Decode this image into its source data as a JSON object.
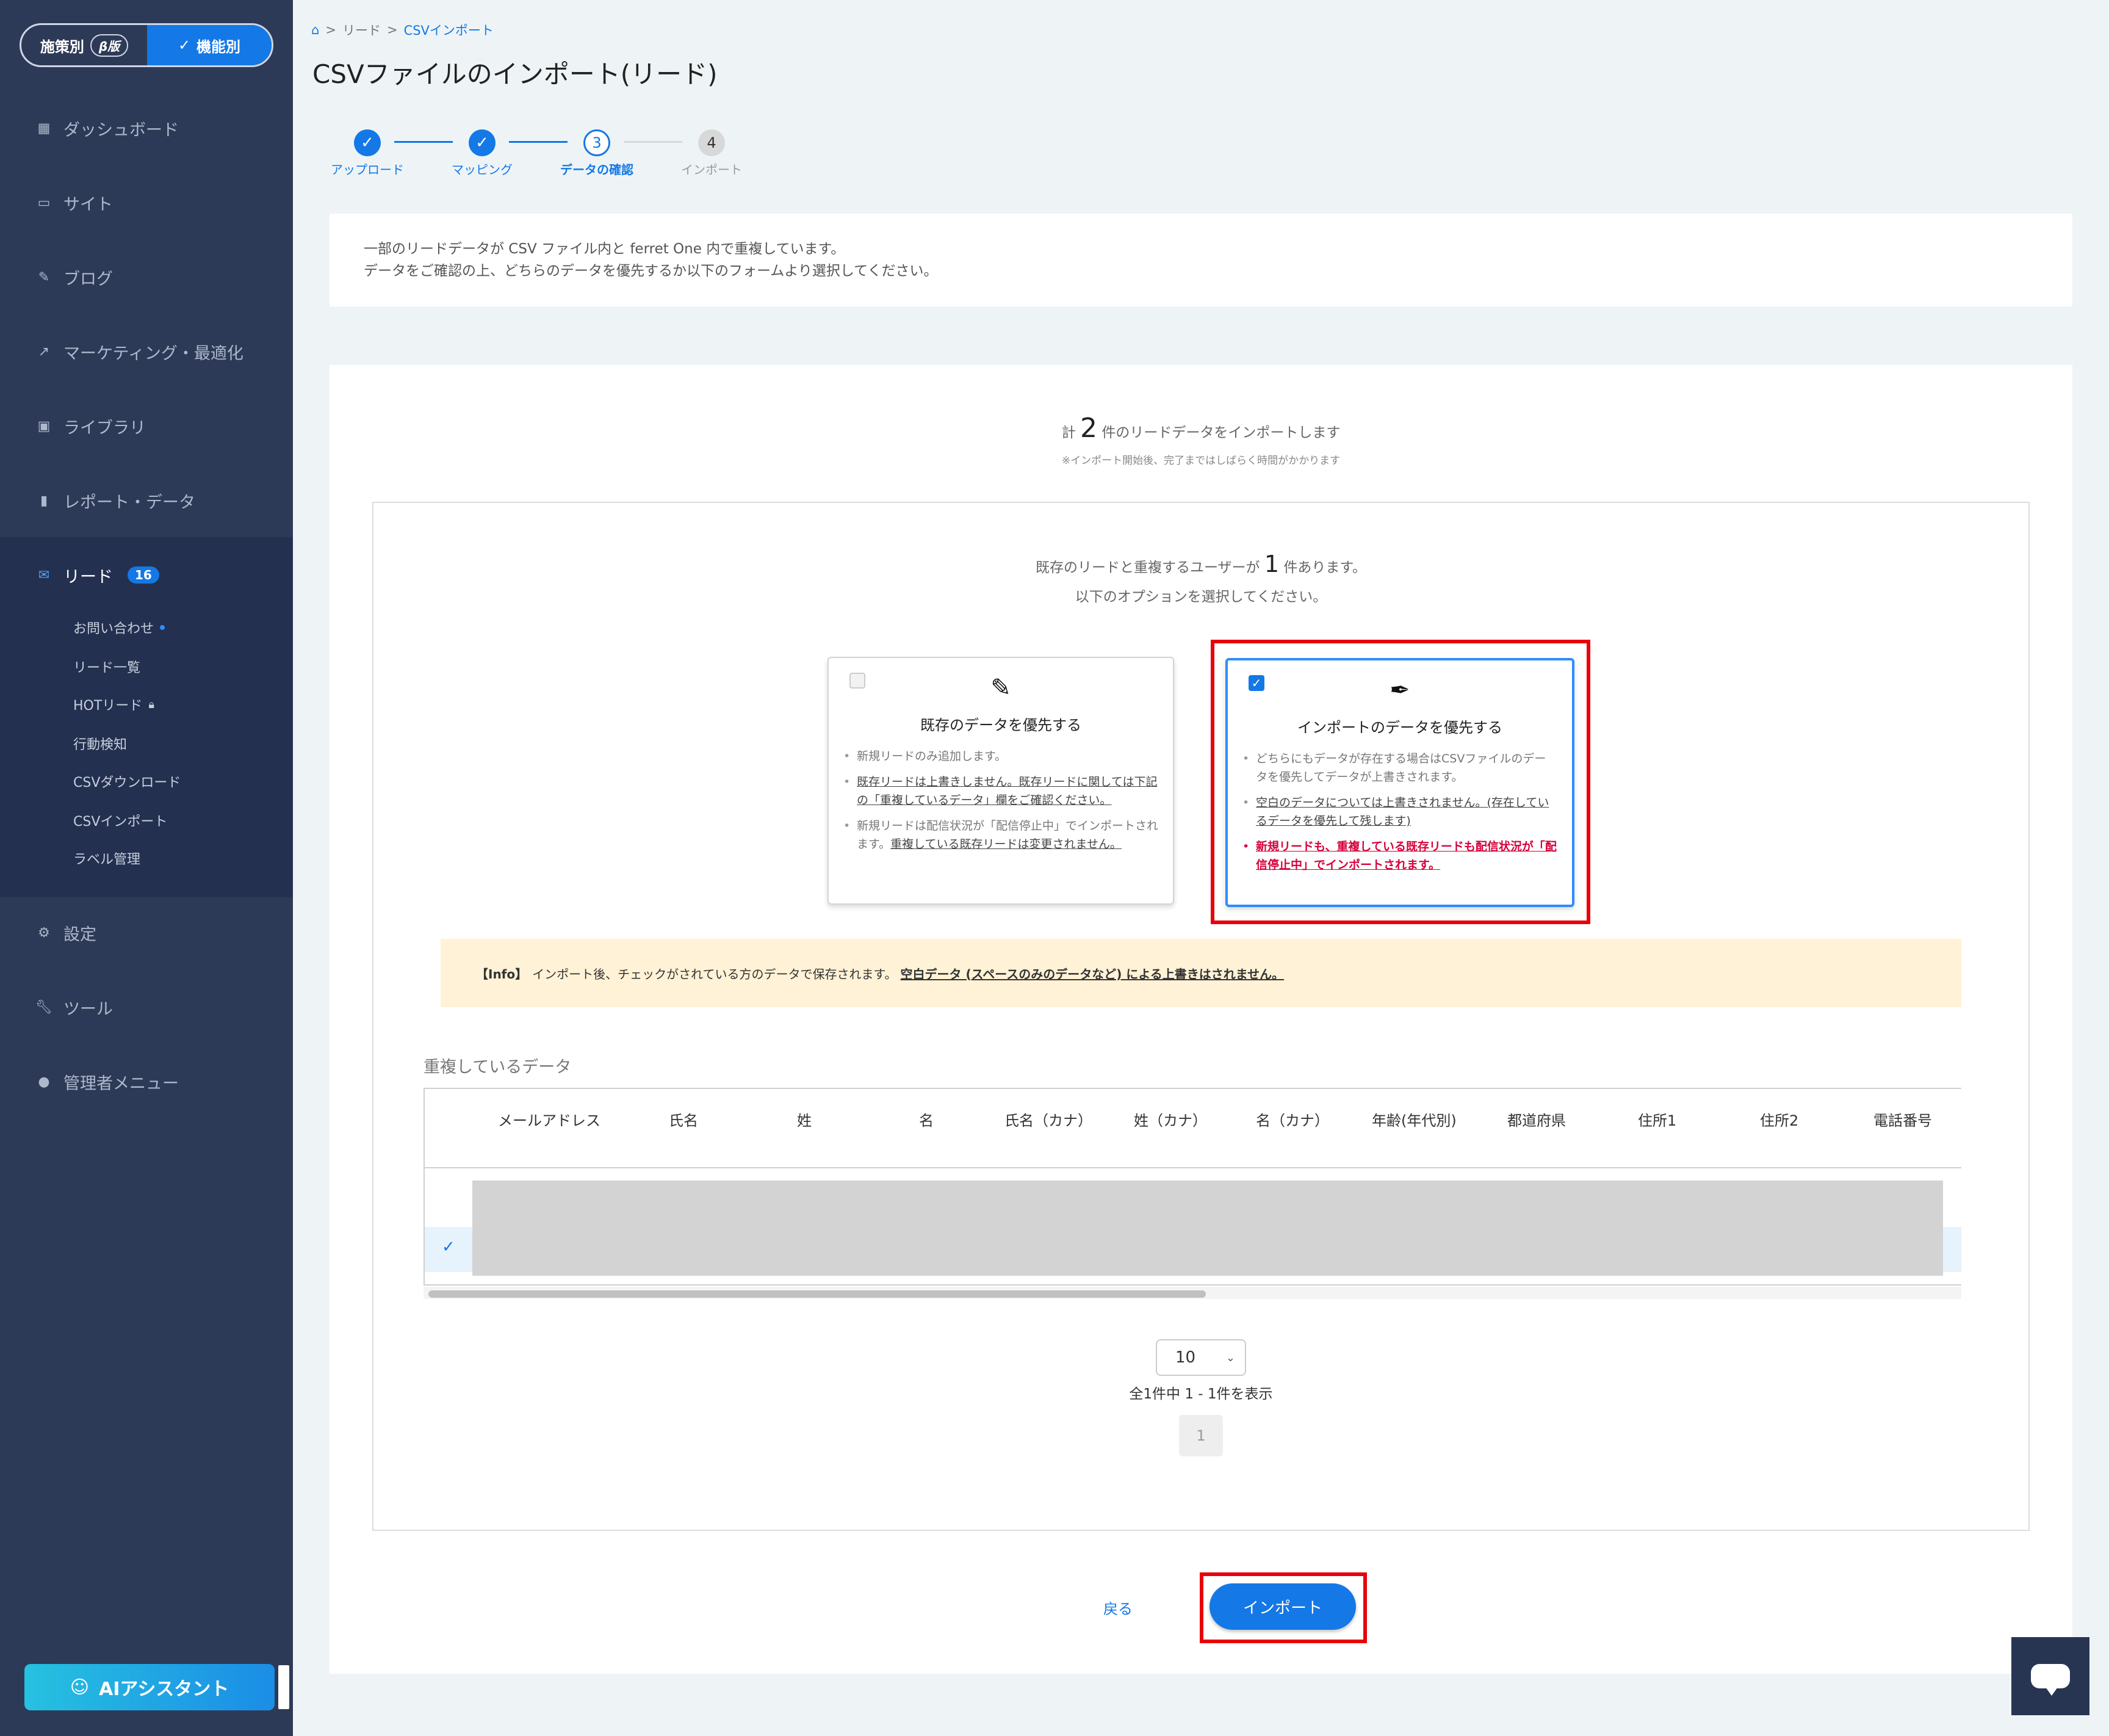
{
  "sidebar": {
    "mode_toggle": {
      "option1": "施策別",
      "option1_badge": "β版",
      "option2": "機能別"
    },
    "items": [
      {
        "label": "ダッシュボード",
        "icon": "dashboard-icon"
      },
      {
        "label": "サイト",
        "icon": "site-icon"
      },
      {
        "label": "ブログ",
        "icon": "pencil-icon"
      },
      {
        "label": "マーケティング・最適化",
        "icon": "trend-icon"
      },
      {
        "label": "ライブラリ",
        "icon": "image-icon"
      },
      {
        "label": "レポート・データ",
        "icon": "bar-chart-icon"
      },
      {
        "label": "リード",
        "icon": "mail-icon",
        "badge": "16"
      },
      {
        "label": "設定",
        "icon": "gear-icon"
      },
      {
        "label": "ツール",
        "icon": "wrench-icon"
      },
      {
        "label": "管理者メニュー",
        "icon": "user-icon"
      }
    ],
    "lead_sub": [
      {
        "label": "お問い合わせ"
      },
      {
        "label": "リード一覧"
      },
      {
        "label": "HOTリード"
      },
      {
        "label": "行動検知"
      },
      {
        "label": "CSVダウンロード"
      },
      {
        "label": "CSVインポート"
      },
      {
        "label": "ラベル管理"
      }
    ],
    "ai_button": "AIアシスタント"
  },
  "breadcrumb": {
    "sep": ">",
    "items": [
      "リード",
      "CSVインポート"
    ]
  },
  "page_title": "CSVファイルのインポート(リード)",
  "stepper": {
    "steps": [
      {
        "label": "アップロード",
        "num": "1",
        "state": "done"
      },
      {
        "label": "マッピング",
        "num": "2",
        "state": "done"
      },
      {
        "label": "データの確認",
        "num": "3",
        "state": "current"
      },
      {
        "label": "インポート",
        "num": "4",
        "state": "todo"
      }
    ]
  },
  "notice": {
    "line1": "一部のリードデータが CSV ファイル内と ferret One 内で重複しています。",
    "line2": "データをご確認の上、どちらのデータを優先するか以下のフォームより選択してください。"
  },
  "summary": {
    "prefix": "計",
    "count": "2",
    "suffix": "件のリードデータをインポートします",
    "note": "※インポート開始後、完了まではしばらく時間がかかります"
  },
  "duplicate": {
    "prefix": "既存のリードと重複するユーザーが",
    "count": "1",
    "suffix": "件あります。",
    "line2": "以下のオプションを選択してください。"
  },
  "options": {
    "existing": {
      "title": "既存のデータを優先する",
      "checked": false,
      "b1": "新規リードのみ追加します。",
      "b2": "既存リードは上書きしません。既存リードに関しては下記の「重複しているデータ」欄をご確認ください。",
      "b3_plain": "新規リードは配信状況が「配信停止中」でインポートされます。",
      "b3_link": "重複している既存リードは変更されません。"
    },
    "import": {
      "title": "インポートのデータを優先する",
      "checked": true,
      "b1": "どちらにもデータが存在する場合はCSVファイルのデータを優先してデータが上書きされます。",
      "b2": "空白のデータについては上書きされません。(存在しているデータを優先して残します)",
      "b3": "新規リードも、重複している既存リードも配信状況が「配信停止中」でインポートされます。"
    }
  },
  "info": {
    "tag": "【Info】",
    "text": "インポート後、チェックがされている方のデータで保存されます。",
    "link": "空白データ (スペースのみのデータなど) による上書きはされません。"
  },
  "dup_table": {
    "title": "重複しているデータ",
    "columns": [
      "メールアドレス",
      "氏名",
      "姓",
      "名",
      "氏名（カナ）",
      "姓（カナ）",
      "名（カナ）",
      "年齢(年代別)",
      "都道府県",
      "住所1",
      "住所2",
      "電話番号"
    ]
  },
  "pagination": {
    "per_page": "10",
    "count_text": "全1件中 1 - 1件を表示",
    "page": "1"
  },
  "actions": {
    "back": "戻る",
    "import": "インポート"
  },
  "colors": {
    "sidebar": "#2d3a57",
    "accent": "#1478e6",
    "highlight": "#e8000b",
    "info_bg": "#fff2d6"
  }
}
